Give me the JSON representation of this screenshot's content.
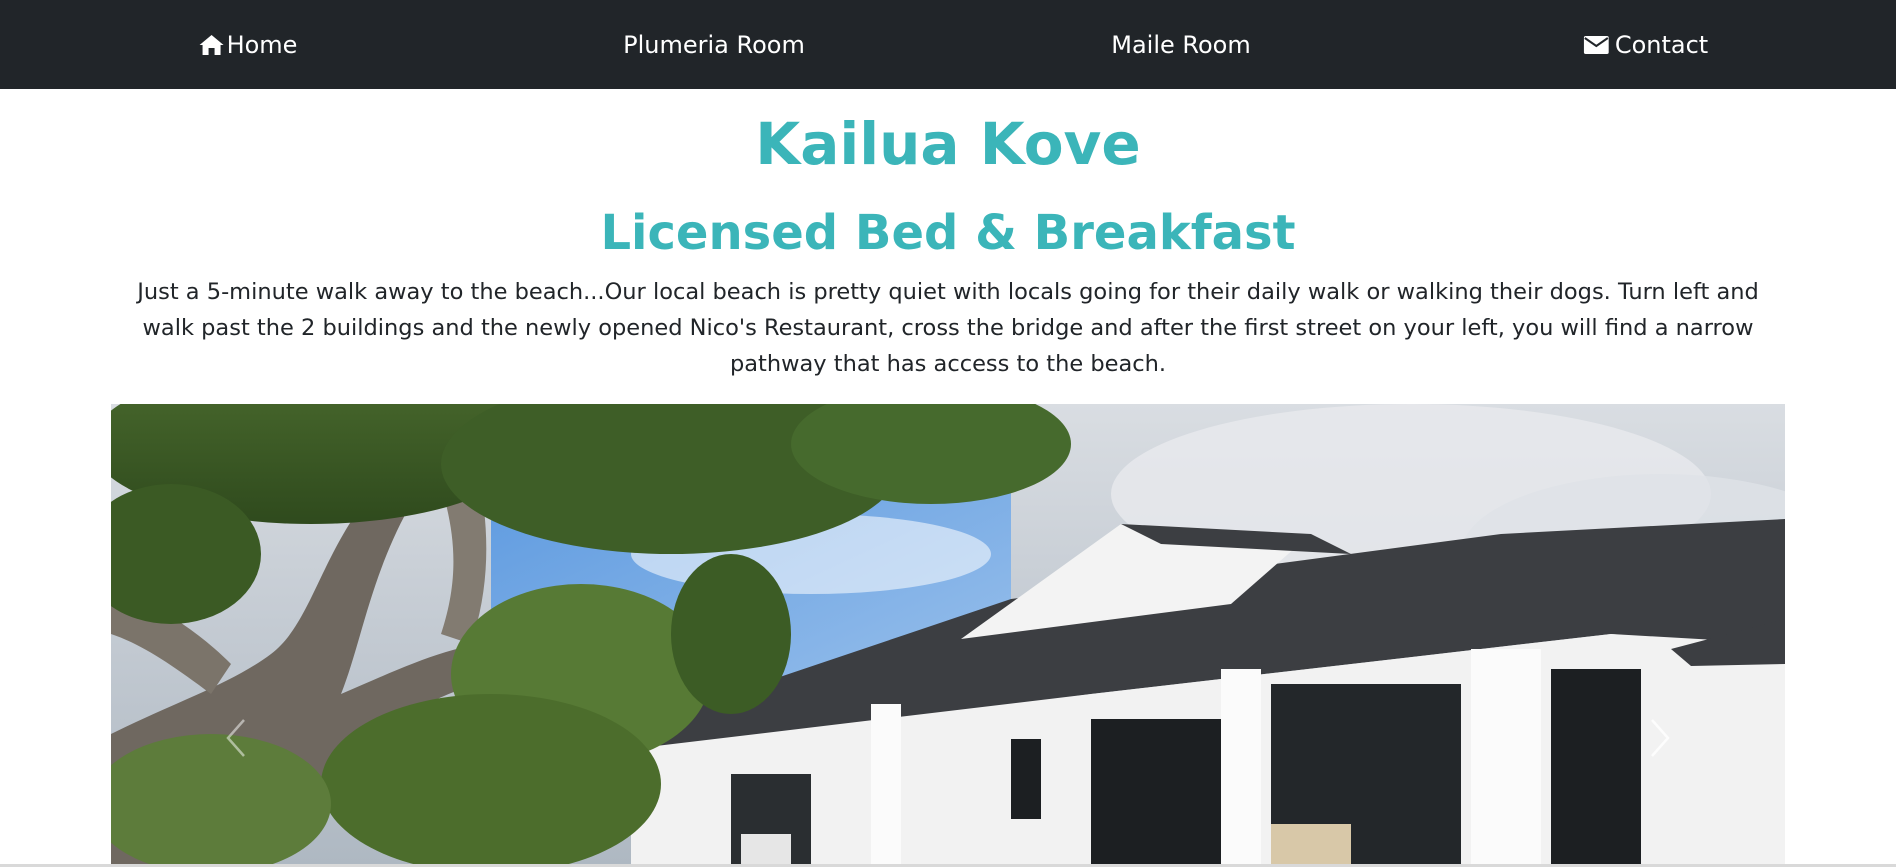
{
  "nav": {
    "home": {
      "label": "Home",
      "icon": "home-icon"
    },
    "plumeria": {
      "label": "Plumeria Room"
    },
    "maile": {
      "label": "Maile Room"
    },
    "contact": {
      "label": "Contact",
      "icon": "envelope-icon"
    },
    "background": "#212529"
  },
  "header": {
    "title": "Kailua Kove",
    "subtitle": "Licensed Bed & Breakfast",
    "accent_color": "#3bb5b9"
  },
  "intro": {
    "text": "Just a 5-minute walk away to the beach...Our local beach is pretty quiet with locals going for their daily walk or walking their dogs. Turn left and walk past the 2 buildings and the newly opened Nico's Restaurant, cross the bridge and after the first street on your left, you will find a narrow pathway that has access to the beach."
  },
  "carousel": {
    "prev_icon": "chevron-left-icon",
    "next_icon": "chevron-right-icon"
  }
}
